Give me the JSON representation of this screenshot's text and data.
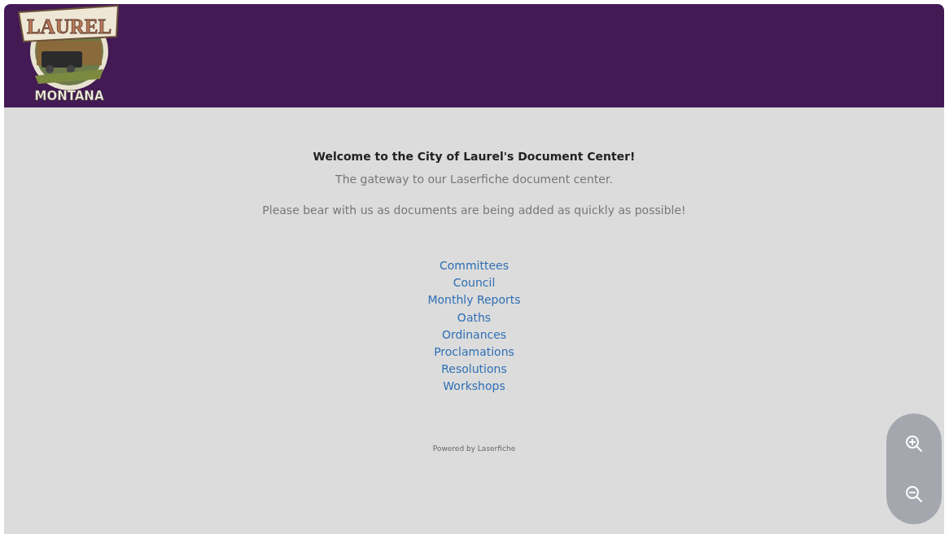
{
  "header": {
    "logo": {
      "top_text": "LAUREL",
      "bottom_text": "MONTANA"
    }
  },
  "welcome": {
    "title": "Welcome to the City of Laurel's Document Center!",
    "subtitle": "The gateway to our Laserfiche document center.",
    "notice": "Please bear with us as documents are being added as quickly as possible!"
  },
  "links": [
    {
      "label": "Committees"
    },
    {
      "label": "Council"
    },
    {
      "label": "Monthly Reports"
    },
    {
      "label": "Oaths"
    },
    {
      "label": "Ordinances"
    },
    {
      "label": "Proclamations"
    },
    {
      "label": "Resolutions"
    },
    {
      "label": "Workshops"
    }
  ],
  "footer": "Powered by Laserfiche",
  "zoom_controls": {
    "kind": "vertical"
  }
}
